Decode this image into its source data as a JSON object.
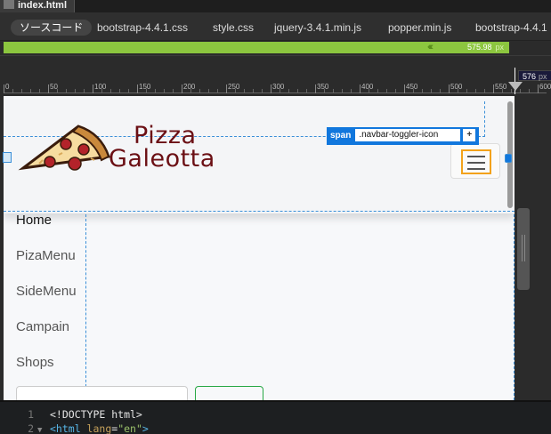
{
  "file_tab": {
    "name": "index.html"
  },
  "related_files": [
    "ソースコード",
    "bootstrap-4.4.1.css",
    "style.css",
    "jquery-3.4.1.min.js",
    "popper.min.js",
    "bootstrap-4.4.1"
  ],
  "media_query": {
    "value": "575.98",
    "unit": "px"
  },
  "width_readout": {
    "value": "576",
    "unit": "px"
  },
  "ruler_labels": [
    "0",
    "50",
    "100",
    "150",
    "200",
    "250",
    "300",
    "350",
    "400",
    "450",
    "500",
    "550",
    "600"
  ],
  "brand": {
    "line1": "Pizza",
    "line2": "Galeotta"
  },
  "selection_badge": {
    "tag": "span",
    "class_value": ".navbar-toggler-icon",
    "add": "+"
  },
  "menu_items": [
    "Home",
    "PizaMenu",
    "SideMenu",
    "Campain",
    "Shops"
  ],
  "code_lines": [
    {
      "num": "1",
      "fold": "",
      "parts": [
        {
          "t": "text",
          "v": "<!DOCTYPE html>"
        }
      ]
    },
    {
      "num": "2",
      "fold": "▼",
      "parts": [
        {
          "t": "tag",
          "v": "<html "
        },
        {
          "t": "attr",
          "v": "lang"
        },
        {
          "t": "text",
          "v": "="
        },
        {
          "t": "str",
          "v": "\"en\""
        },
        {
          "t": "tag",
          "v": ">"
        }
      ]
    }
  ],
  "colors": {
    "accent_green": "#8cc63f",
    "selection_blue": "#1177dd",
    "brand_red": "#6b0f14",
    "toggler_highlight": "#f3a21a"
  },
  "icons": {
    "file": "html-file-icon",
    "menu": "hamburger-icon",
    "logo": "pizza-slice-logo"
  }
}
